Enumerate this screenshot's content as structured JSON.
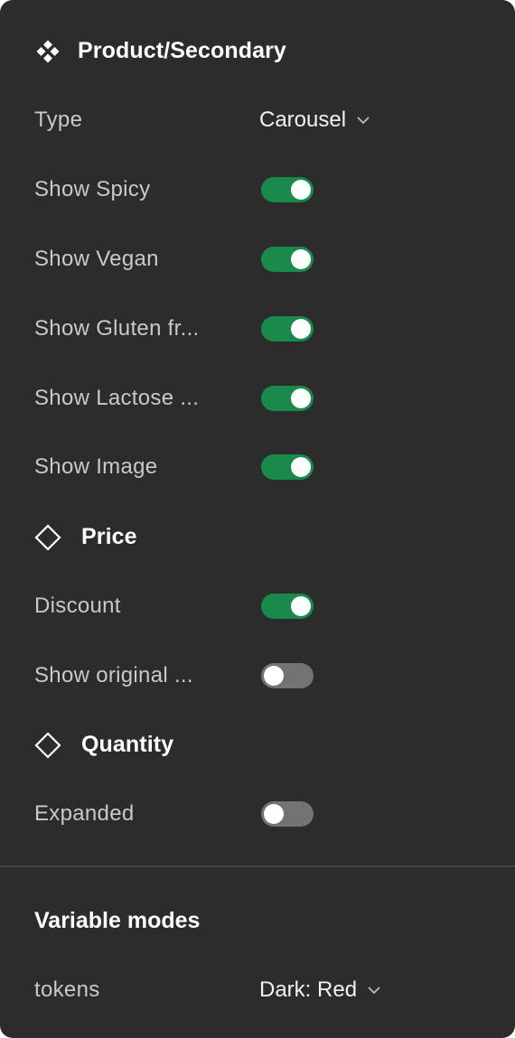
{
  "component": {
    "title": "Product/Secondary",
    "icon": "component-icon"
  },
  "properties": [
    {
      "label": "Type",
      "kind": "dropdown",
      "value": "Carousel"
    },
    {
      "label": "Show Spicy",
      "kind": "toggle",
      "state": "on"
    },
    {
      "label": "Show Vegan",
      "kind": "toggle",
      "state": "on"
    },
    {
      "label": "Show Gluten fr...",
      "kind": "toggle",
      "state": "on"
    },
    {
      "label": "Show Lactose ...",
      "kind": "toggle",
      "state": "on"
    },
    {
      "label": "Show Image",
      "kind": "toggle",
      "state": "on"
    }
  ],
  "price": {
    "title": "Price",
    "icon": "instance-diamond-icon",
    "properties": [
      {
        "label": "Discount",
        "kind": "toggle",
        "state": "on"
      },
      {
        "label": "Show original ...",
        "kind": "toggle",
        "state": "off"
      }
    ]
  },
  "quantity": {
    "title": "Quantity",
    "icon": "instance-diamond-icon",
    "properties": [
      {
        "label": "Expanded",
        "kind": "toggle",
        "state": "off"
      }
    ]
  },
  "variable_modes": {
    "title": "Variable modes",
    "rows": [
      {
        "label": "tokens",
        "kind": "dropdown",
        "value": "Dark: Red"
      }
    ]
  },
  "colors": {
    "panel_bg": "#2c2c2c",
    "toggle_on": "#1a8a4c",
    "toggle_off": "#737373",
    "label": "#c9c9c9",
    "divider": "#444444"
  }
}
